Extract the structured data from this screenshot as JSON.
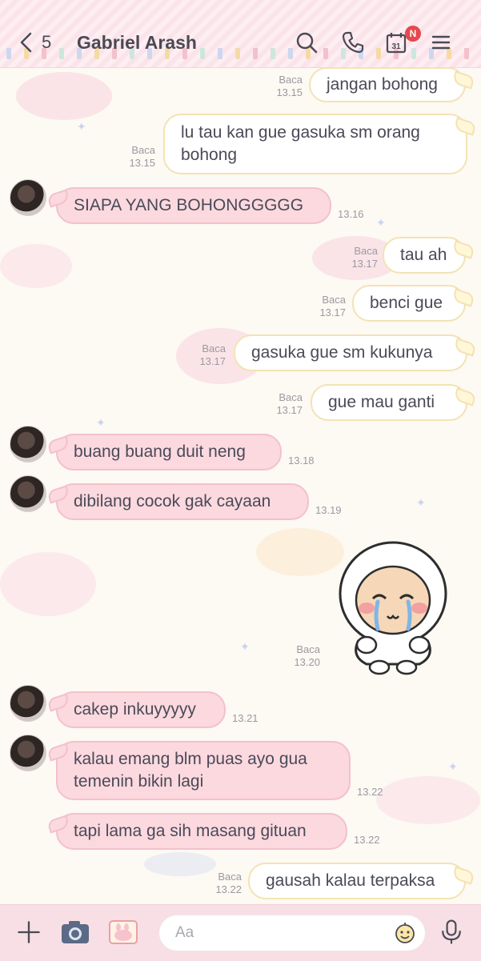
{
  "header": {
    "back_count": "5",
    "title": "Gabriel Arash",
    "calendar_day": "31",
    "calendar_badge": "N",
    "colors": {
      "background": "#fbe3ea",
      "badge": "#e5484d"
    }
  },
  "messages": [
    {
      "side": "out",
      "text": "jangan bohong",
      "read": "Baca",
      "time": "13.15"
    },
    {
      "side": "out",
      "text": "lu tau kan gue gasuka sm orang bohong",
      "line1": "lu tau kan gue gasuka sm orang",
      "line2": "bohong",
      "read": "Baca",
      "time": "13.15"
    },
    {
      "side": "in",
      "text": "SIAPA YANG BOHONGGGGG",
      "time": "13.16"
    },
    {
      "side": "out",
      "text": "tau ah",
      "read": "Baca",
      "time": "13.17"
    },
    {
      "side": "out",
      "text": "benci gue",
      "read": "Baca",
      "time": "13.17"
    },
    {
      "side": "out",
      "text": "gasuka gue sm kukunya",
      "read": "Baca",
      "time": "13.17"
    },
    {
      "side": "out",
      "text": "gue mau ganti",
      "read": "Baca",
      "time": "13.17"
    },
    {
      "side": "in",
      "text": "buang buang duit neng",
      "time": "13.18"
    },
    {
      "side": "in",
      "text": "dibilang cocok gak cayaan",
      "time": "13.19"
    },
    {
      "side": "out",
      "type": "sticker",
      "sticker": "crying-white-hood-sticker",
      "read": "Baca",
      "time": "13.20"
    },
    {
      "side": "in",
      "text": "cakep inkuyyyyy",
      "time": "13.21"
    },
    {
      "side": "in",
      "text": "kalau emang blm puas ayo gua temenin bikin lagi",
      "line1": "kalau emang blm puas ayo gua",
      "line2": "temenin bikin lagi",
      "time": "13.22"
    },
    {
      "side": "in",
      "text": "tapi lama ga sih masang gituan",
      "time": "13.22"
    },
    {
      "side": "out",
      "text": "gausah kalau terpaksa",
      "read": "Baca",
      "time": "13.22"
    }
  ],
  "composer": {
    "placeholder": "Aa",
    "icons": [
      "plus-icon",
      "camera-icon",
      "gallery-icon",
      "emoji-icon",
      "microphone-icon"
    ]
  },
  "colors": {
    "incoming_bubble": "#fbd9df",
    "outgoing_bubble": "#ffffff",
    "wallpaper": "#fdf9f3",
    "bottom_bar": "#f8dfe5"
  }
}
